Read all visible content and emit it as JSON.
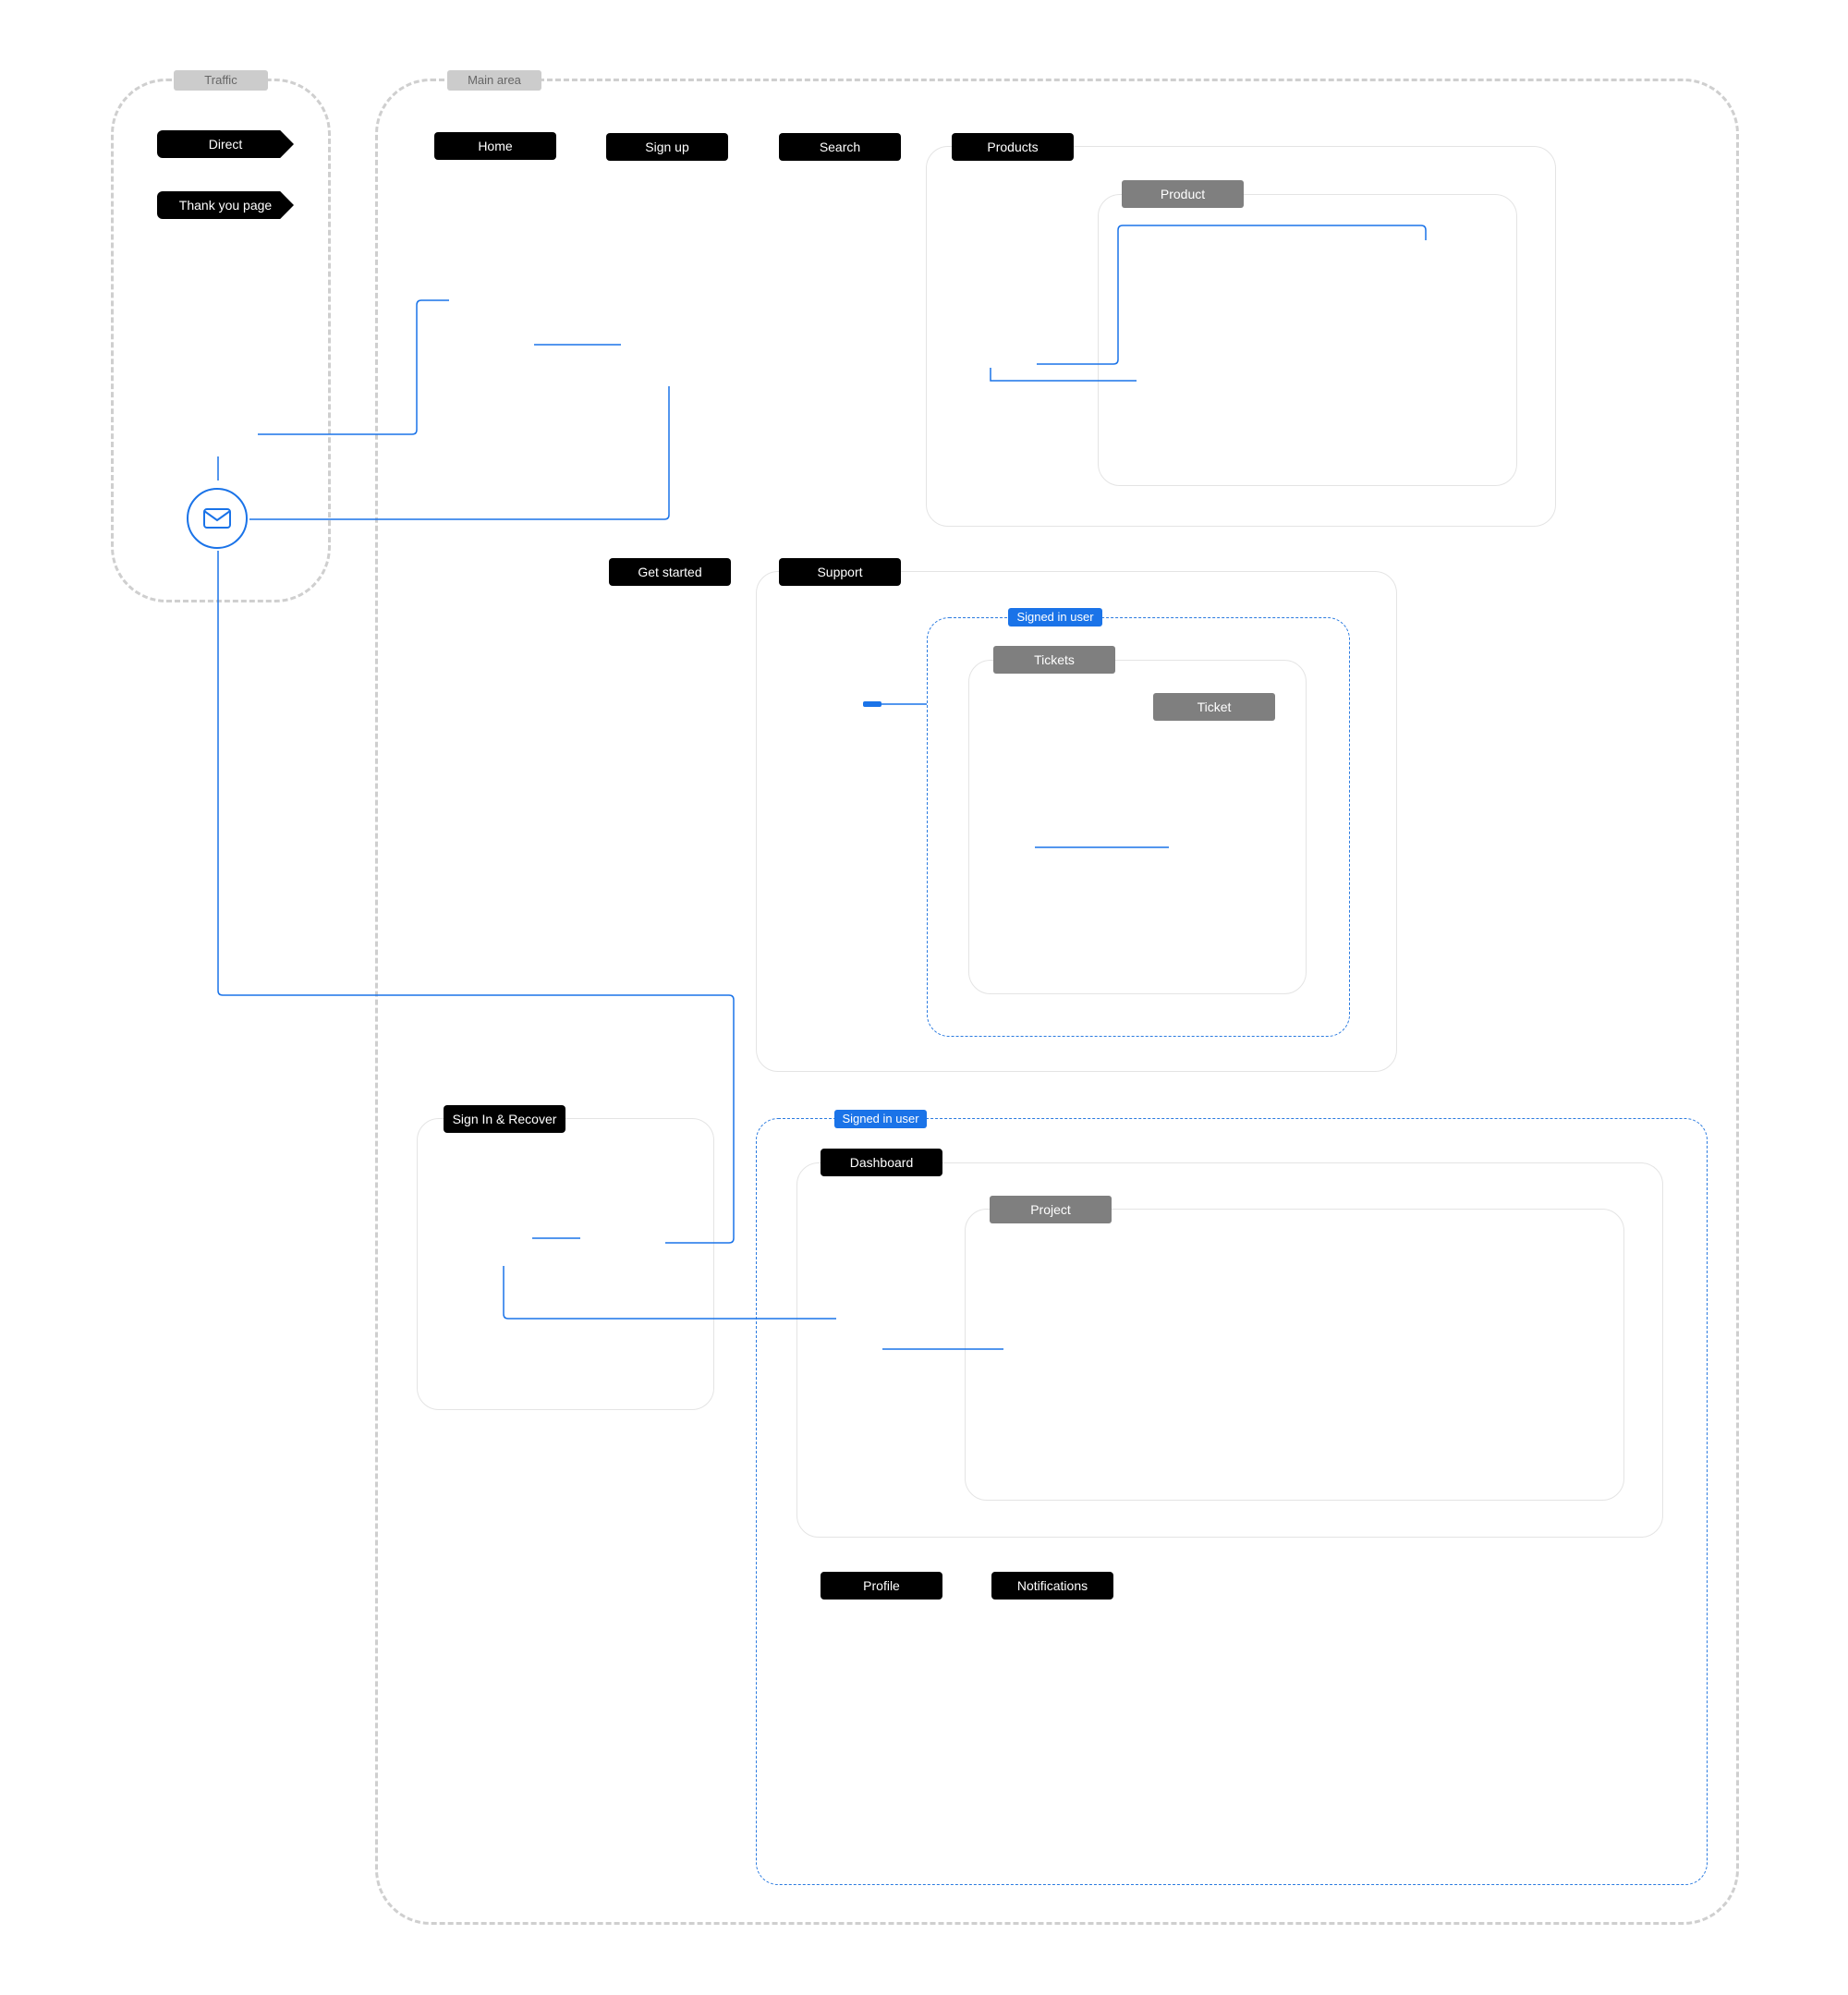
{
  "diagram": {
    "regions": {
      "traffic": "Traffic",
      "main": "Main area"
    },
    "traffic_sources": [
      {
        "label": "Direct"
      },
      {
        "label": "Thank you page"
      }
    ],
    "email_icon": "envelope-icon",
    "pages": {
      "home": "Home",
      "signup": "Sign up",
      "search": "Search",
      "products": "Products",
      "product": "Product",
      "get_started": "Get started",
      "support": "Support",
      "tickets": "Tickets",
      "ticket": "Ticket",
      "signin": "Sign In & Recover",
      "dashboard": "Dashboard",
      "project": "Project",
      "profile": "Profile",
      "notifications": "Notifications"
    },
    "signed_in_labels": [
      "Signed in user",
      "Signed in user"
    ],
    "colors": {
      "connector": "#1a73e8",
      "page_button": "#000000",
      "subpage_button": "#7f7f7f",
      "signed_in_tag": "#1a73e8"
    }
  }
}
